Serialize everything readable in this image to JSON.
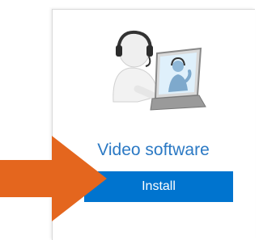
{
  "card": {
    "title": "Video software",
    "install_label": "Install",
    "illustration_icon": "person-video-call-laptop-icon"
  },
  "annotation": {
    "arrow_icon": "pointer-arrow-right-icon",
    "arrow_color": "#e4661e"
  },
  "colors": {
    "title": "#2b79c4",
    "button_bg": "#0074cf",
    "button_text": "#ffffff"
  }
}
